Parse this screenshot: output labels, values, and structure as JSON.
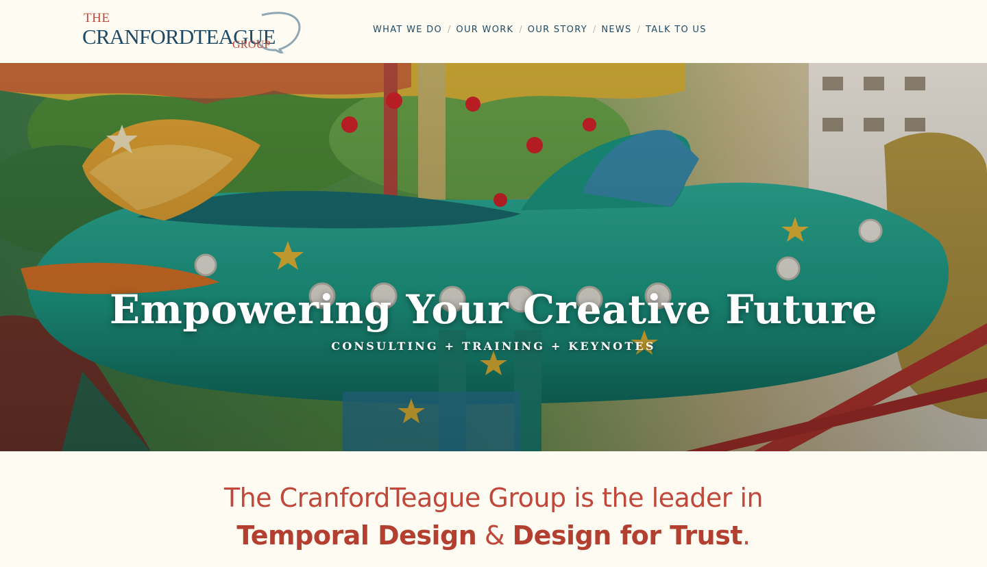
{
  "logo": {
    "the": "THE",
    "main": "CRANFORDTEAGUE",
    "group": "GROUP"
  },
  "nav": {
    "items": [
      {
        "label": "WHAT WE DO"
      },
      {
        "label": "OUR WORK"
      },
      {
        "label": "OUR STORY"
      },
      {
        "label": "NEWS"
      },
      {
        "label": "TALK TO US"
      }
    ],
    "separator": "/"
  },
  "hero": {
    "title": "Empowering Your Creative Future",
    "subtitle": "CONSULTING + TRAINING + KEYNOTES"
  },
  "intro": {
    "line1": "The CranfordTeague Group is the leader in",
    "highlight1": "Temporal Design",
    "amp": "&",
    "highlight2": "Design for Trust",
    "period": "."
  },
  "colors": {
    "brand_blue": "#1f4a66",
    "brand_red": "#c0473a",
    "background": "#fdfbf2"
  }
}
